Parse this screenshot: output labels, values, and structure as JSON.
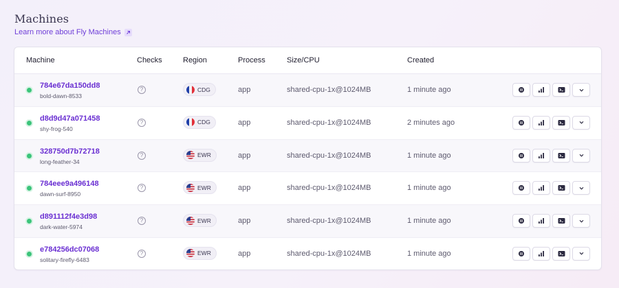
{
  "page": {
    "title": "Machines",
    "learn_more": "Learn more about Fly Machines"
  },
  "table": {
    "headers": {
      "machine": "Machine",
      "checks": "Checks",
      "region": "Region",
      "process": "Process",
      "size": "Size/CPU",
      "created": "Created"
    },
    "rows": [
      {
        "id": "784e67da150dd8",
        "name": "bold-dawn-8533",
        "status": "started",
        "region": "CDG",
        "flag": "fr",
        "process": "app",
        "size": "shared-cpu-1x@1024MB",
        "created": "1 minute ago"
      },
      {
        "id": "d8d9d47a071458",
        "name": "shy-frog-540",
        "status": "started",
        "region": "CDG",
        "flag": "fr",
        "process": "app",
        "size": "shared-cpu-1x@1024MB",
        "created": "2 minutes ago"
      },
      {
        "id": "328750d7b72718",
        "name": "long-feather-34",
        "status": "started",
        "region": "EWR",
        "flag": "us",
        "process": "app",
        "size": "shared-cpu-1x@1024MB",
        "created": "1 minute ago"
      },
      {
        "id": "784eee9a496148",
        "name": "dawn-surf-8950",
        "status": "started",
        "region": "EWR",
        "flag": "us",
        "process": "app",
        "size": "shared-cpu-1x@1024MB",
        "created": "1 minute ago"
      },
      {
        "id": "d891112f4e3d98",
        "name": "dark-water-5974",
        "status": "started",
        "region": "EWR",
        "flag": "us",
        "process": "app",
        "size": "shared-cpu-1x@1024MB",
        "created": "1 minute ago"
      },
      {
        "id": "e784256dc07068",
        "name": "solitary-firefly-6483",
        "status": "started",
        "region": "EWR",
        "flag": "us",
        "process": "app",
        "size": "shared-cpu-1x@1024MB",
        "created": "1 minute ago"
      }
    ]
  },
  "icons": {
    "status": "status-dot",
    "checks": "question-circle-icon",
    "link": "external-link-icon",
    "actions": [
      "pause-icon",
      "metrics-bar-chart-icon",
      "console-terminal-icon",
      "chevron-down-icon"
    ]
  },
  "colors": {
    "accent": "#6a2fd2",
    "status_ok": "#3bc47a"
  }
}
